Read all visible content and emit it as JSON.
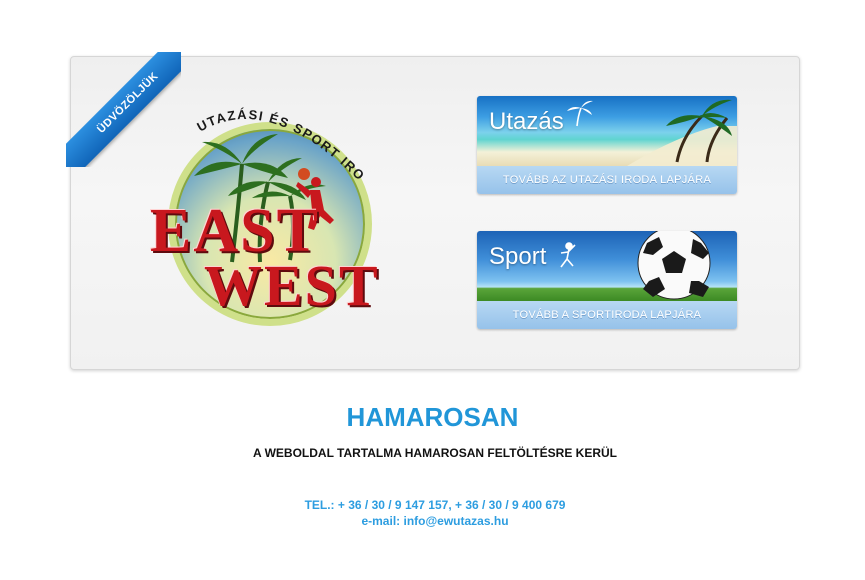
{
  "ribbon": {
    "label": "ÜDVÖZÖLJÜK",
    "color": "#1e7fd0"
  },
  "logo": {
    "arc_text": "UTAZÁSI ÉS SPORT IRODA",
    "east": "EAST",
    "west": "WEST",
    "brand_color": "#c8181e"
  },
  "promos": [
    {
      "title": "Utazás",
      "link_label": "TOVÁBB AZ UTAZÁSI IRODA LAPJÁRA",
      "icon": "palm-icon"
    },
    {
      "title": "Sport",
      "link_label": "TOVÁBB A SPORTIRODA LAPJÁRA",
      "icon": "player-icon"
    }
  ],
  "heading": "HAMAROSAN",
  "subheading": "A WEBOLDAL TARTALMA HAMAROSAN FELTÖLTÉSRE KERÜL",
  "contact": {
    "tel": "TEL.: + 36 / 30 / 9 147 157, + 36 / 30 / 9 400 679",
    "email": "e-mail: info@ewutazas.hu"
  },
  "colors": {
    "accent": "#2196d8",
    "link_bar": "#a6cdef"
  }
}
